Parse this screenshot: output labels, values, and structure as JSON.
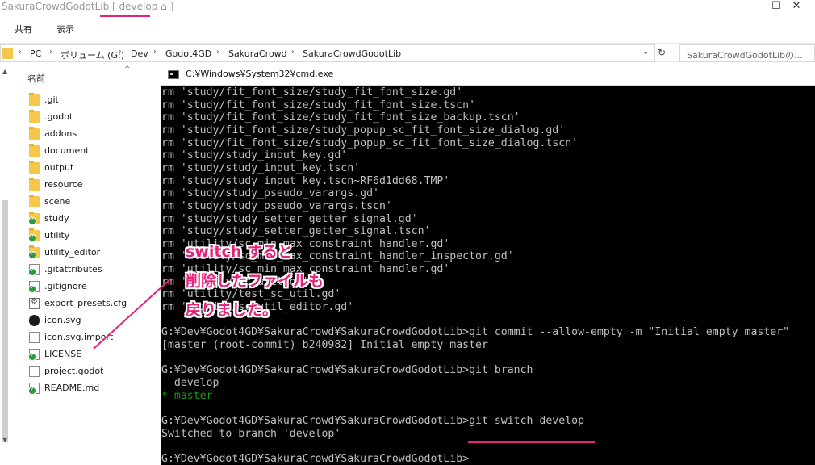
{
  "explorer": {
    "title": "SakuraCrowdGodotLib",
    "branch_badge": "[ develop ⌂ ]",
    "window_controls": {
      "minimize": "—",
      "maximize": "☐",
      "close": "✕"
    },
    "ribbon_tabs": [
      "共有",
      "表示"
    ],
    "address": {
      "crumbs": [
        "PC",
        "ボリューム (G:)",
        "Dev",
        "Godot4GD",
        "SakuraCrowd",
        "SakuraCrowdGodotLib"
      ],
      "separator": "›",
      "dropdown": "⌄",
      "refresh": "↻"
    },
    "search": {
      "placeholder": "SakuraCrowdGodotLibの..."
    },
    "columns": {
      "name": "名前",
      "sort": "^"
    },
    "files": [
      {
        "name": ".git",
        "icon": "folder-icon",
        "git": false
      },
      {
        "name": ".godot",
        "icon": "folder-icon",
        "git": false
      },
      {
        "name": "addons",
        "icon": "folder-icon",
        "git": false
      },
      {
        "name": "document",
        "icon": "folder-icon",
        "git": false
      },
      {
        "name": "output",
        "icon": "folder-icon",
        "git": false
      },
      {
        "name": "resource",
        "icon": "folder-icon",
        "git": false
      },
      {
        "name": "scene",
        "icon": "folder-icon",
        "git": false
      },
      {
        "name": "study",
        "icon": "folder-icon",
        "git": true
      },
      {
        "name": "utility",
        "icon": "folder-icon",
        "git": true
      },
      {
        "name": "utility_editor",
        "icon": "folder-icon",
        "git": true
      },
      {
        "name": ".gitattributes",
        "icon": "document-icon",
        "git": true
      },
      {
        "name": ".gitignore",
        "icon": "document-icon",
        "git": true
      },
      {
        "name": "export_presets.cfg",
        "icon": "settings-file-icon",
        "git": false
      },
      {
        "name": "icon.svg",
        "icon": "svg-file-icon",
        "git": false
      },
      {
        "name": "icon.svg.import",
        "icon": "document-icon",
        "git": false
      },
      {
        "name": "LICENSE",
        "icon": "document-icon",
        "git": true
      },
      {
        "name": "project.godot",
        "icon": "document-icon",
        "git": false
      },
      {
        "name": "README.md",
        "icon": "document-icon",
        "git": true
      }
    ]
  },
  "console": {
    "title": "C:¥Windows¥System32¥cmd.exe",
    "lines": [
      {
        "text": "rm 'study/fit_font_size/study_fit_font_size.gd'",
        "color": "default"
      },
      {
        "text": "rm 'study/fit_font_size/study_fit_font_size.tscn'",
        "color": "default"
      },
      {
        "text": "rm 'study/fit_font_size/study_fit_font_size_backup.tscn'",
        "color": "default"
      },
      {
        "text": "rm 'study/fit_font_size/study_popup_sc_fit_font_size_dialog.gd'",
        "color": "default"
      },
      {
        "text": "rm 'study/fit_font_size/study_popup_sc_fit_font_size_dialog.tscn'",
        "color": "default"
      },
      {
        "text": "rm 'study/study_input_key.gd'",
        "color": "default"
      },
      {
        "text": "rm 'study/study_input_key.tscn'",
        "color": "default"
      },
      {
        "text": "rm 'study/study_input_key.tscn~RF6d1dd68.TMP'",
        "color": "default"
      },
      {
        "text": "rm 'study/study_pseudo_varargs.gd'",
        "color": "default"
      },
      {
        "text": "rm 'study/study_pseudo_varargs.tscn'",
        "color": "default"
      },
      {
        "text": "rm 'study/study_setter_getter_signal.gd'",
        "color": "default"
      },
      {
        "text": "rm 'study/study_setter_getter_signal.tscn'",
        "color": "default"
      },
      {
        "text": "rm 'utility/sc_min_max_constraint_handler.gd'",
        "color": "default"
      },
      {
        "text": "rm 'utility/sc_min_max_constraint_handler_inspector.gd'",
        "color": "default"
      },
      {
        "text": "rm 'utility/sc_min_max_constraint_handler.gd'",
        "color": "default"
      },
      {
        "text": "rm 'utility/sc_util.gd'",
        "color": "default"
      },
      {
        "text": "rm 'utility/test_sc_util.gd'",
        "color": "default"
      },
      {
        "text": "rm 'utility/sc_util_editor.gd'",
        "color": "default"
      },
      {
        "text": "",
        "color": "default"
      },
      {
        "text": "G:¥Dev¥Godot4GD¥SakuraCrowd¥SakuraCrowdGodotLib>git commit --allow-empty -m \"Initial empty master\"",
        "color": "default"
      },
      {
        "text": "[master (root-commit) b240982] Initial empty master",
        "color": "default"
      },
      {
        "text": "",
        "color": "default"
      },
      {
        "text": "G:¥Dev¥Godot4GD¥SakuraCrowd¥SakuraCrowdGodotLib>git branch",
        "color": "default"
      },
      {
        "text": "  develop",
        "color": "default"
      },
      {
        "text": "* master",
        "color": "green"
      },
      {
        "text": "",
        "color": "default"
      },
      {
        "text": "G:¥Dev¥Godot4GD¥SakuraCrowd¥SakuraCrowdGodotLib>git switch develop",
        "color": "default"
      },
      {
        "text": "Switched to branch 'develop'",
        "color": "default"
      },
      {
        "text": "",
        "color": "default"
      },
      {
        "text": "G:¥Dev¥Godot4GD¥SakuraCrowd¥SakuraCrowdGodotLib>",
        "color": "default"
      }
    ]
  },
  "annotation": {
    "lines": [
      "switch すると",
      "削除したファイルも",
      "戻りました。"
    ],
    "color": "#e8227a"
  },
  "colors": {
    "console_bg": "#000000",
    "console_fg": "#c0c0c0",
    "console_green": "#13a10e",
    "accent": "#e8227a",
    "folder": "#f5c84c",
    "git_badge": "#2b9a3c"
  }
}
